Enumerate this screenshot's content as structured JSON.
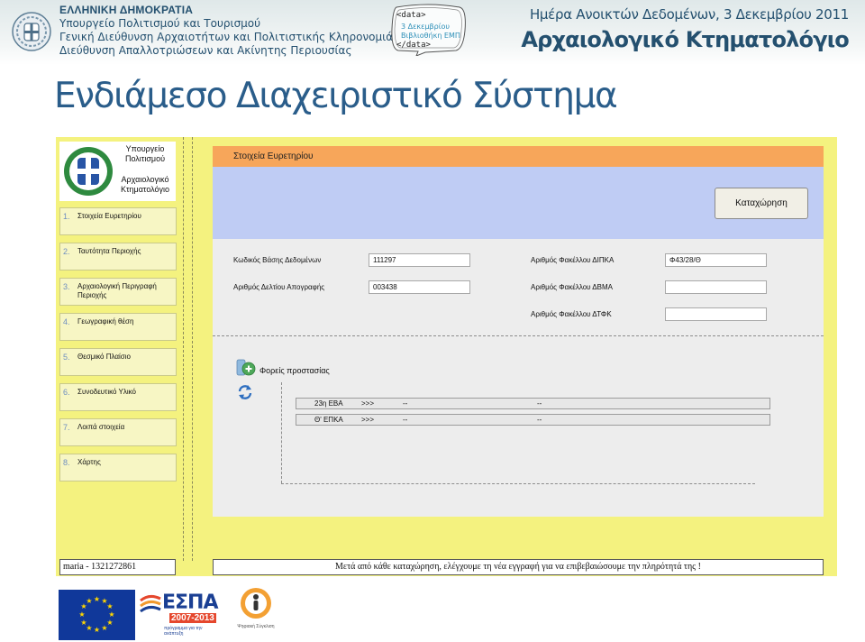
{
  "header": {
    "ministry_lines": [
      "ΕΛΛΗΝΙΚΗ ΔΗΜΟΚΡΑΤΙΑ",
      "Υπουργείο Πολιτισμού και Τουρισμού",
      "Γενική Διεύθυνση Αρχαιοτήτων και Πολιτιστικής Κληρονομιάς",
      "Διεύθυνση Απαλλοτριώσεων και Ακίνητης Περιουσίας"
    ],
    "data_bubble": {
      "open_tag": "<data>",
      "line1": "3 Δεκεμβρίου",
      "line2": "Βιβλιοθήκη ΕΜΠ",
      "close_tag": "</data>"
    },
    "event_title": "Ημέρα Ανοικτών Δεδομένων, 3 Δεκεμβρίου 2011",
    "project_title": "Αρχαιολογικό Κτηματολόγιο"
  },
  "slide_title": "Ενδιάμεσο Διαχειριστικό Σύστημα",
  "app": {
    "logo": {
      "line1": "Υπουργείο",
      "line2": "Πολιτισμού",
      "line3": "Αρχαιολογικό",
      "line4": "Κτηματολόγιο"
    },
    "nav": [
      {
        "num": "1.",
        "label": "Στοιχεία Ευρετηρίου"
      },
      {
        "num": "2.",
        "label": "Ταυτότητα Περιοχής"
      },
      {
        "num": "3.",
        "label": "Αρχαιολογική Περιγραφή Περιοχής"
      },
      {
        "num": "4.",
        "label": "Γεωγραφική θέση"
      },
      {
        "num": "5.",
        "label": "Θεσμικό Πλαίσιο"
      },
      {
        "num": "6.",
        "label": "Συνοδευτικό Υλικό"
      },
      {
        "num": "7.",
        "label": "Λοιπά στοιχεία"
      },
      {
        "num": "8.",
        "label": "Χάρτης"
      }
    ],
    "section_title": "Στοιχεία Ευρετηρίου",
    "submit_label": "Καταχώρηση",
    "fields": {
      "db_code_label": "Κωδικός Βάσης Δεδομένων",
      "db_code_value": "111297",
      "inventory_label": "Αριθμός Δελτίου Απογραφής",
      "inventory_value": "003438",
      "dipka_label": "Αριθμός Φακέλλου ΔΙΠΚΑ",
      "dipka_value": "Φ43/28/Θ",
      "dvma_label": "Αριθμός Φακέλλου ΔΒΜΑ",
      "dvma_value": "",
      "dtfk_label": "Αριθμός Φακέλλου ΔΤΦΚ",
      "dtfk_value": ""
    },
    "protection_label": "Φορείς προστασίας",
    "agencies": [
      {
        "name": "23η ΕΒΑ",
        "arrow": ">>>",
        "c1": "--",
        "c2": "--"
      },
      {
        "name": "Θ' ΕΠΚΑ",
        "arrow": ">>>",
        "c1": "--",
        "c2": "--"
      }
    ],
    "footer_user": "maria",
    "footer_sep": " - ",
    "footer_id": "1321272861",
    "footer_message": "Μετά από κάθε καταχώρηση, ελέγχουμε τη νέα εγγραφή για να επιβεβαιώσουμε την πληρότητά της !"
  },
  "footer_logos": {
    "espa_text": "ΕΣΠΑ",
    "espa_years": "2007-2013",
    "espa_tagline": "πρόγραμμα για την ανάπτυξη",
    "digital_text": "Ψηφιακή Σύγκλιση"
  },
  "colors": {
    "app_yellow": "#f4f27f",
    "header_orange": "#f7a65a",
    "band_blue": "#bfccf4",
    "title_blue": "#2a5d8a"
  }
}
